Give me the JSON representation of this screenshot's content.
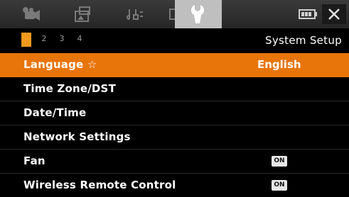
{
  "tabs": [
    {
      "name": "camera",
      "icon": "movie-camera-icon",
      "active": false
    },
    {
      "name": "playback",
      "icon": "photo-playback-icon",
      "active": false
    },
    {
      "name": "audio",
      "icon": "audio-mic-icon",
      "active": false
    },
    {
      "name": "display",
      "icon": "lcd-display-icon",
      "active": false
    },
    {
      "name": "setup",
      "icon": "wrench-icon",
      "active": true
    }
  ],
  "header": {
    "battery_icon": "battery-icon",
    "close_icon": "close-icon"
  },
  "pages": {
    "items": [
      "1",
      "2",
      "3",
      "4"
    ],
    "current": "1"
  },
  "section_title": "System Setup",
  "menu": {
    "items": [
      {
        "label": "Language ☆",
        "value": "English",
        "selected": true
      },
      {
        "label": "Time Zone/DST",
        "value": "",
        "selected": false
      },
      {
        "label": "Date/Time",
        "value": "",
        "selected": false
      },
      {
        "label": "Network Settings",
        "value": "",
        "selected": false
      },
      {
        "label": "Fan",
        "value": "ON",
        "selected": false
      },
      {
        "label": "Wireless Remote Control",
        "value": "ON",
        "selected": false
      }
    ]
  },
  "colors": {
    "selection": "#e8750a",
    "page_active": "#f39a1e",
    "background": "#000000",
    "tab_active": "#bfbfbf"
  }
}
